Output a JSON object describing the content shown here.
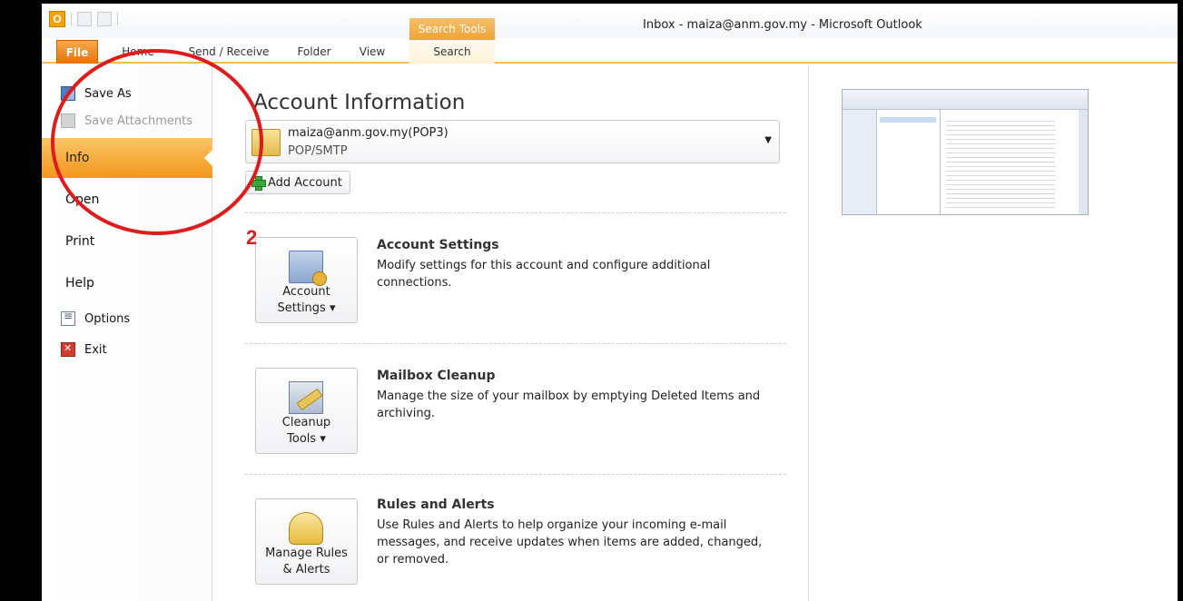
{
  "window": {
    "title": "Inbox - maiza@anm.gov.my  -  Microsoft Outlook",
    "contextual_tab_group": "Search Tools",
    "app_icon_letter": "O"
  },
  "ribbon": {
    "tabs": [
      {
        "label": "File",
        "selected": true
      },
      {
        "label": "Home"
      },
      {
        "label": "Send / Receive"
      },
      {
        "label": "Folder"
      },
      {
        "label": "View"
      },
      {
        "label": "Search"
      }
    ]
  },
  "backstage_nav": {
    "items": [
      {
        "label": "Save As",
        "icon": "save-as-icon",
        "enabled": true
      },
      {
        "label": "Save Attachments",
        "icon": "save-attachments-icon",
        "enabled": false
      },
      {
        "label": "Info",
        "selected": true
      },
      {
        "label": "Open"
      },
      {
        "label": "Print"
      },
      {
        "label": "Help"
      },
      {
        "label": "Options",
        "icon": "options-icon"
      },
      {
        "label": "Exit",
        "icon": "exit-icon"
      }
    ]
  },
  "main": {
    "title": "Account Information",
    "account": {
      "email": "maiza@anm.gov.my(POP3)",
      "type": "POP/SMTP"
    },
    "add_account_label": "Add Account",
    "sections": [
      {
        "button_label_line1": "Account",
        "button_label_line2": "Settings ▾",
        "title": "Account Settings",
        "description": "Modify settings for this account and configure additional connections."
      },
      {
        "button_label_line1": "Cleanup",
        "button_label_line2": "Tools ▾",
        "title": "Mailbox Cleanup",
        "description": "Manage the size of your mailbox by emptying Deleted Items and archiving."
      },
      {
        "button_label_line1": "Manage Rules",
        "button_label_line2": "& Alerts",
        "title": "Rules and Alerts",
        "description": "Use Rules and Alerts to help organize your incoming e-mail messages, and receive updates when items are added, changed, or removed."
      }
    ]
  },
  "annotation": {
    "step_number": "2",
    "color": "#e01b1b"
  },
  "colors": {
    "accent_orange": "#f3961c",
    "file_tab": "#e4720c"
  }
}
